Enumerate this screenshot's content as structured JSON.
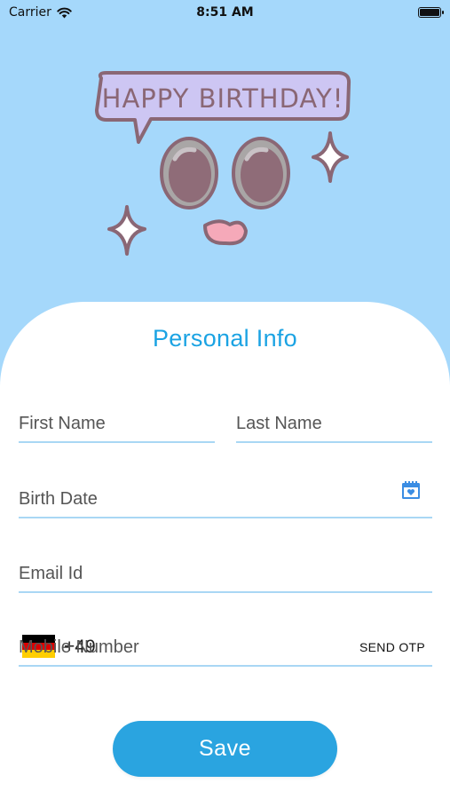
{
  "status_bar": {
    "carrier": "Carrier",
    "time": "8:51 AM"
  },
  "illustration": {
    "banner_text": "HAPPY BIRTHDAY!"
  },
  "form": {
    "title": "Personal Info",
    "first_name_placeholder": "First Name",
    "last_name_placeholder": "Last Name",
    "birth_date_placeholder": "Birth Date",
    "email_placeholder": "Email Id",
    "country_code": "+49",
    "mobile_placeholder": "Mobile Number",
    "send_otp_label": "SEND OTP",
    "save_label": "Save"
  },
  "colors": {
    "background": "#a5d8fb",
    "accent": "#1ba3e3",
    "button": "#2aa4e0",
    "underline": "#a9d7f4"
  },
  "icons": [
    "wifi-icon",
    "battery-icon",
    "calendar-icon",
    "germany-flag-icon"
  ]
}
